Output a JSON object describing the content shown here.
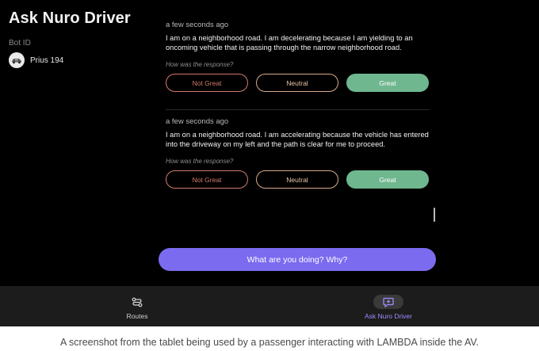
{
  "header": {
    "title": "Ask Nuro Driver",
    "bot_id_label": "Bot ID",
    "bot_name": "Prius 194"
  },
  "messages": [
    {
      "time": "a few seconds ago",
      "text": "I am on a neighborhood road. I am decelerating because I am yielding to an oncoming vehicle that is passing through the narrow neighborhood road.",
      "feedback_question": "How was the response?",
      "feedback": {
        "not_great": "Not Great",
        "neutral": "Neutral",
        "great": "Great",
        "selected": "Great"
      }
    },
    {
      "time": "a few seconds ago",
      "text": "I am on a neighborhood road. I am accelerating because the vehicle has entered into the driveway on my left and the path is clear for me to proceed.",
      "feedback_question": "How was the response?",
      "feedback": {
        "not_great": "Not Great",
        "neutral": "Neutral",
        "great": "Great",
        "selected": "Great"
      }
    }
  ],
  "ask_button": "What are you doing? Why?",
  "tabs": [
    {
      "label": "Routes",
      "icon": "routes-icon",
      "active": false
    },
    {
      "label": "Ask Nuro Driver",
      "icon": "chat-icon",
      "active": true
    }
  ],
  "caption": "A screenshot from the tablet being used by a passenger interacting with LAMBDA inside the AV.",
  "colors": {
    "background": "#000000",
    "accent": "#7b6bef",
    "great": "#6fb78f",
    "not_great": "#d27a6b",
    "neutral": "#d6a98a",
    "tabbar": "#1c1c1c"
  }
}
